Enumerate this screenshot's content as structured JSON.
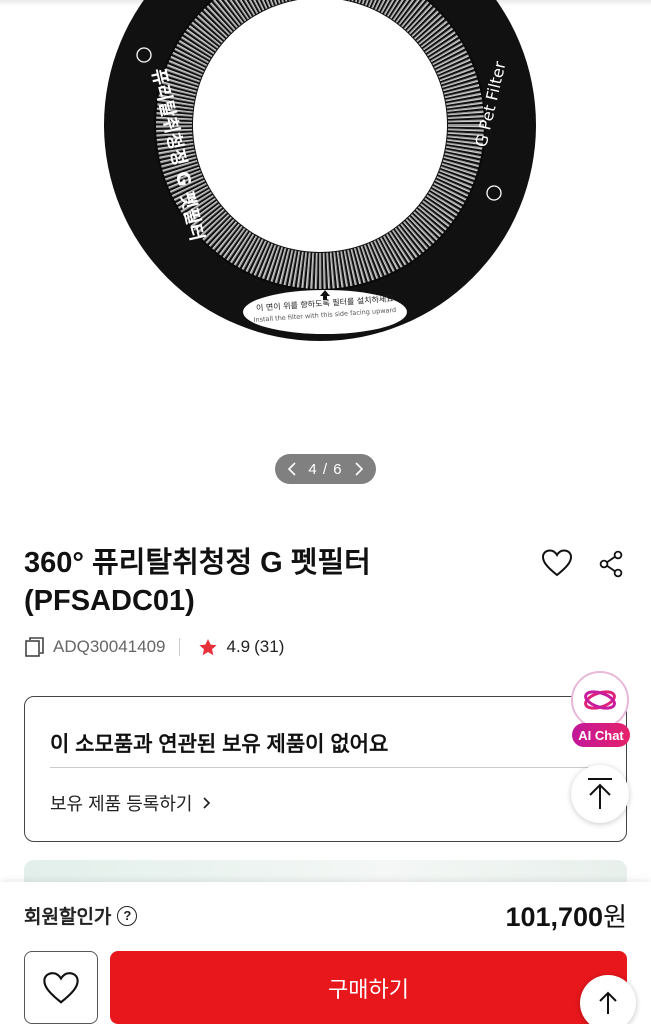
{
  "gallery": {
    "current": "4",
    "separator": "/",
    "total": "6",
    "filter_label_ko": "퓨리탈취청정 G 펫필터",
    "filter_label_en": "G Pet Filter",
    "install_notice_ko": "이 면이 위를 향하도록 필터를 설치하세요",
    "install_notice_en": "Install the filter with this side facing upward"
  },
  "product": {
    "title": "360° 퓨리탈취청정 G 펫필터 (PFSADC01)",
    "model_code": "ADQ30041409",
    "rating": "4.9",
    "review_count": "(31)"
  },
  "owned_card": {
    "title": "이 소모품과 연관된 보유 제품이 없어요",
    "link_label": "보유 제품 등록하기"
  },
  "ai_chat": {
    "label": "AI Chat"
  },
  "purchase": {
    "member_price_label": "회원할인가",
    "help_glyph": "?",
    "price": "101,700",
    "currency": "원",
    "buy_label": "구매하기"
  },
  "colors": {
    "accent": "#e8171c",
    "star": "#e8303a",
    "pager_bg": "#808080"
  },
  "icons": [
    "chevron-left-icon",
    "chevron-right-icon",
    "heart-icon",
    "share-icon",
    "copy-icon",
    "star-icon",
    "chevron-right-icon",
    "ai-chat-icon",
    "arrow-up-icon",
    "question-icon"
  ]
}
